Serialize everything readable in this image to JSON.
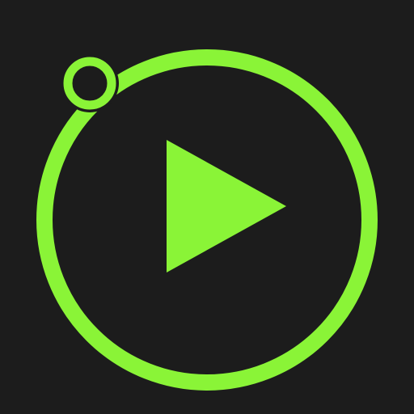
{
  "icon": {
    "name": "media-player-app-icon",
    "colors": {
      "background": "#1c1c1c",
      "accent": "#8af437"
    },
    "glyph": "play-icon",
    "ring": "progress-ring",
    "knob": "progress-knob"
  }
}
